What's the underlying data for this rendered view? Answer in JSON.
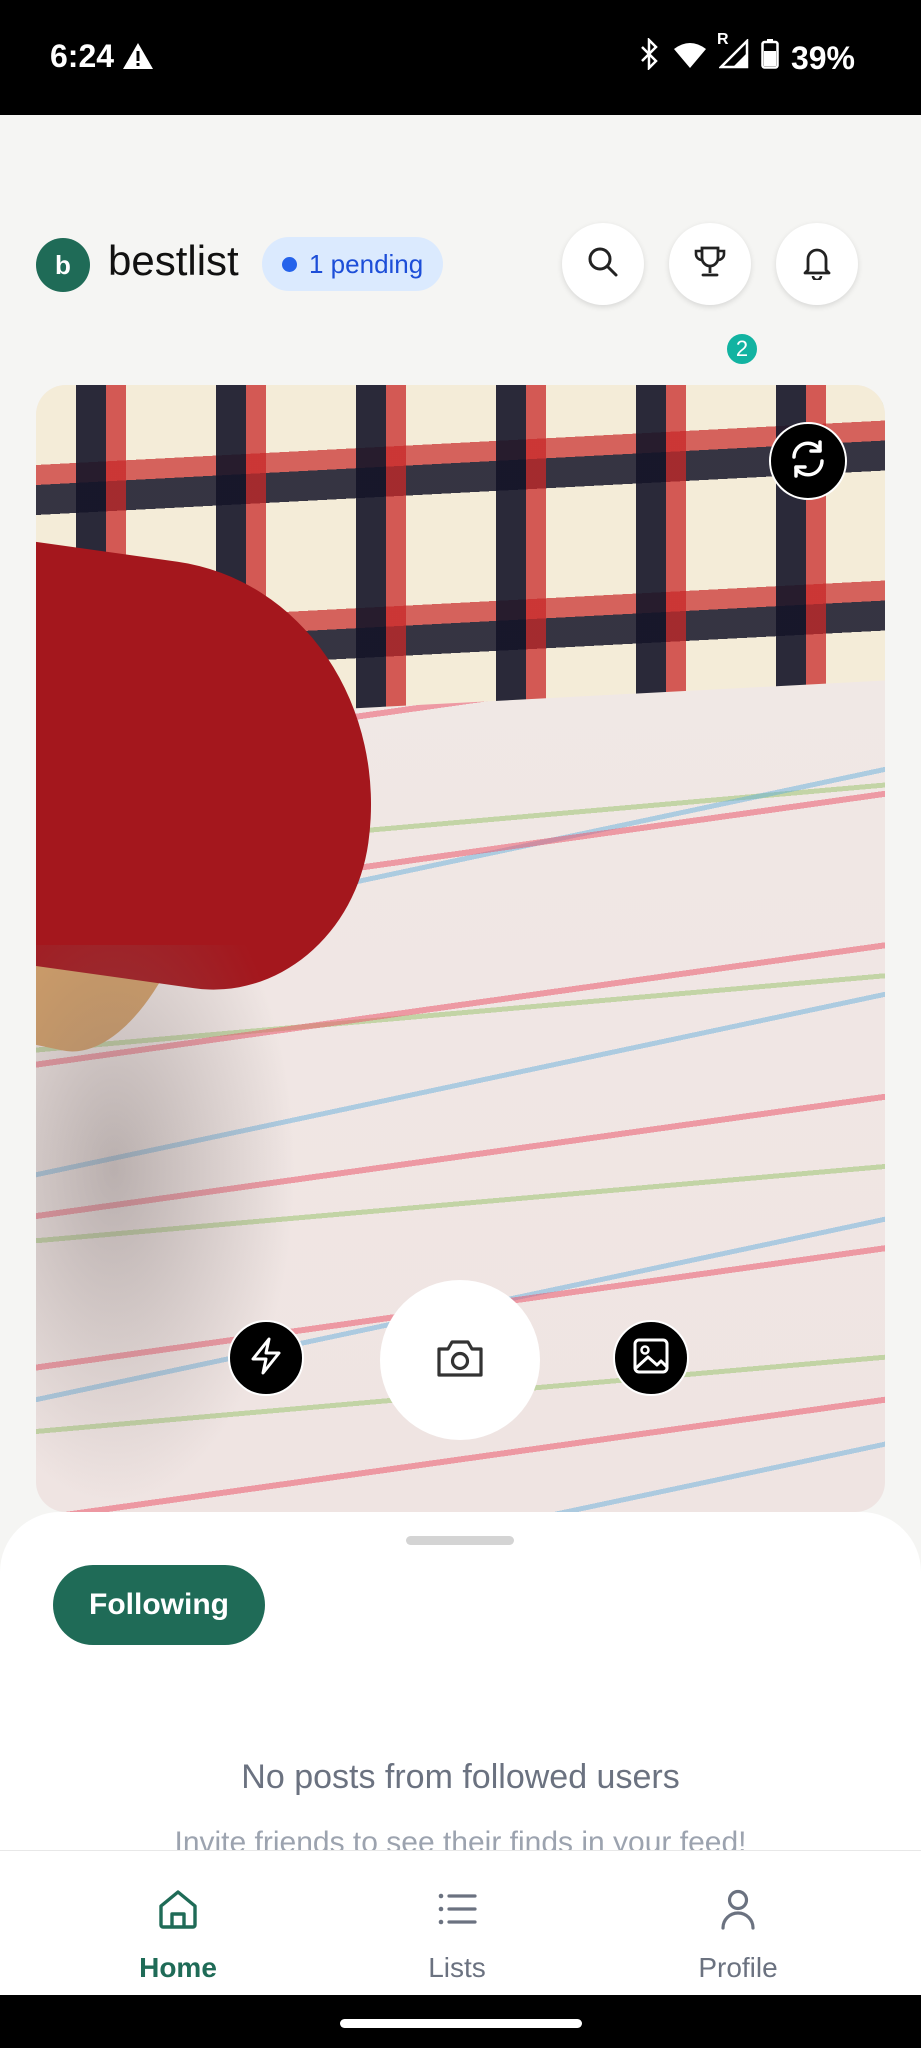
{
  "status_bar": {
    "time": "6:24",
    "battery": "39%",
    "signal_label": "R"
  },
  "header": {
    "avatar_letter": "b",
    "app_name": "bestlist",
    "pending": "1 pending",
    "trophy_badge": "2"
  },
  "camera": {},
  "feed": {
    "filter_label": "Following",
    "empty_title": "No posts from followed users",
    "empty_subtitle": "Invite friends to see their finds in your feed!"
  },
  "nav": {
    "home": "Home",
    "lists": "Lists",
    "profile": "Profile"
  },
  "colors": {
    "brand": "#1f6b57",
    "pending_bg": "#dbeafe",
    "pending_text": "#1d4ed8",
    "badge": "#12b3a1"
  }
}
